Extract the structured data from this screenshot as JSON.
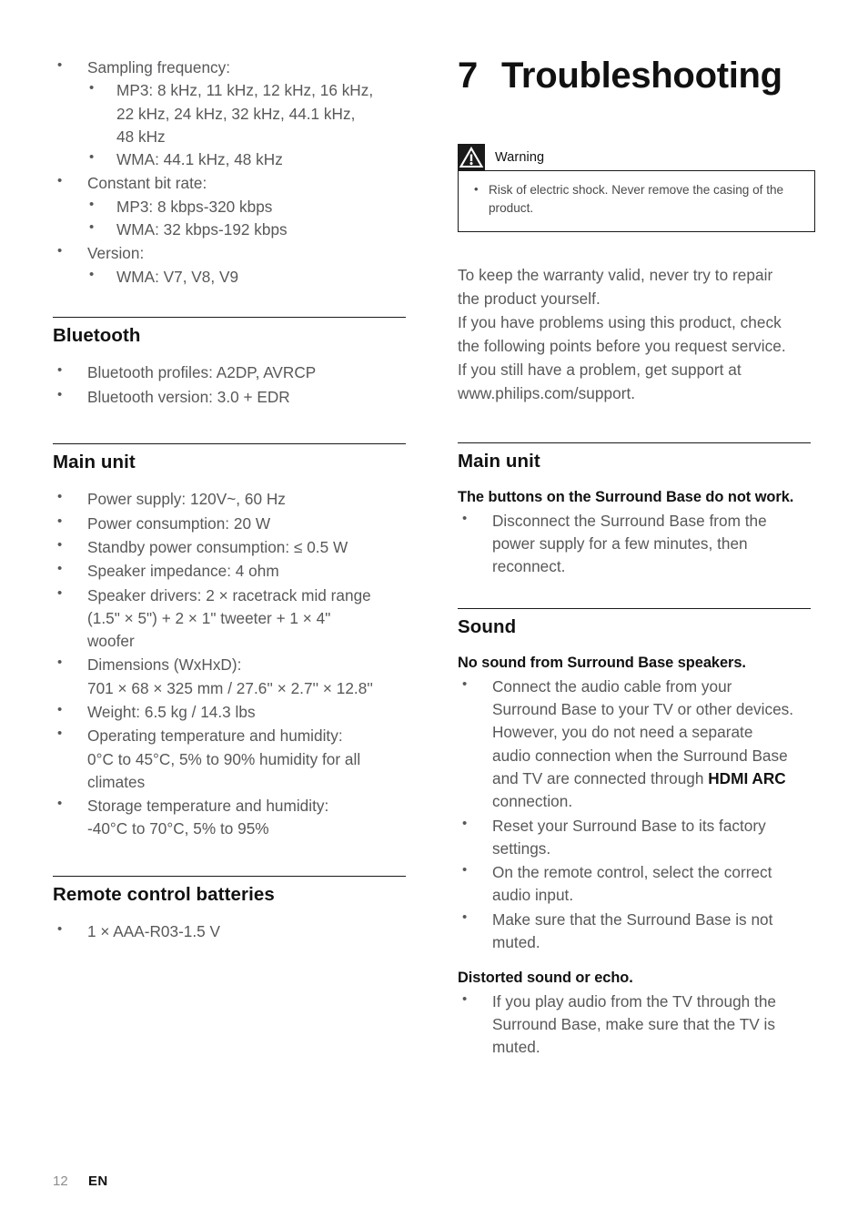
{
  "page": {
    "number": "12",
    "language": "EN"
  },
  "left_column": {
    "audio_specs": {
      "items": [
        {
          "label": "Sampling frequency:",
          "sub": [
            {
              "lines": [
                "MP3: 8 kHz, 11 kHz, 12 kHz, 16 kHz,",
                "22 kHz, 24 kHz, 32 kHz, 44.1 kHz,",
                "48 kHz"
              ]
            },
            {
              "lines": [
                "WMA: 44.1 kHz, 48 kHz"
              ]
            }
          ]
        },
        {
          "label": "Constant bit rate:",
          "sub": [
            {
              "lines": [
                "MP3: 8 kbps-320 kbps"
              ]
            },
            {
              "lines": [
                "WMA: 32 kbps-192 kbps"
              ]
            }
          ]
        },
        {
          "label": "Version:",
          "sub": [
            {
              "lines": [
                "WMA: V7, V8, V9"
              ]
            }
          ]
        }
      ]
    },
    "bluetooth": {
      "title": "Bluetooth",
      "items": [
        "Bluetooth profiles: A2DP, AVRCP",
        "Bluetooth version: 3.0 + EDR"
      ]
    },
    "main_unit": {
      "title": "Main unit",
      "items": [
        {
          "lines": [
            "Power supply: 120V~, 60 Hz"
          ]
        },
        {
          "lines": [
            "Power consumption: 20 W"
          ]
        },
        {
          "lines": [
            "Standby power consumption: ≤ 0.5 W"
          ]
        },
        {
          "lines": [
            "Speaker impedance: 4 ohm"
          ]
        },
        {
          "lines": [
            "Speaker drivers: 2 × racetrack mid range",
            "(1.5\" × 5\") + 2 × 1\" tweeter + 1 × 4\"",
            "woofer"
          ]
        },
        {
          "lines": [
            "Dimensions (WxHxD):",
            "701 × 68 × 325 mm / 27.6'' × 2.7'' × 12.8''"
          ]
        },
        {
          "lines": [
            "Weight: 6.5 kg / 14.3 lbs"
          ]
        },
        {
          "lines": [
            "Operating temperature and humidity:",
            "0°C to 45°C, 5% to 90% humidity for all",
            "climates"
          ]
        },
        {
          "lines": [
            "Storage temperature and humidity:",
            "-40°C to 70°C, 5% to 95%"
          ]
        }
      ]
    },
    "remote_batteries": {
      "title": "Remote control batteries",
      "items": [
        "1 × AAA-R03-1.5 V"
      ]
    }
  },
  "right_column": {
    "chapter": {
      "number": "7",
      "title": "Troubleshooting"
    },
    "warning": {
      "label": "Warning",
      "icon": "warning-triangle-icon",
      "items": [
        "Risk of electric shock. Never remove the casing of the product."
      ]
    },
    "intro": {
      "lines": [
        "To keep the warranty valid, never try to repair",
        "the product yourself.",
        "If you have problems using this product, check",
        "the following points before you request service.",
        "If you still have a problem, get support at",
        "www.philips.com/support."
      ]
    },
    "main_unit": {
      "title": "Main unit",
      "problems": [
        {
          "heading_lines": [
            "The buttons on the Surround Base do not",
            "work."
          ],
          "solutions": [
            {
              "lines": [
                "Disconnect the Surround Base from the",
                "power supply for a few minutes, then",
                "reconnect."
              ]
            }
          ]
        }
      ]
    },
    "sound": {
      "title": "Sound",
      "problems": [
        {
          "heading_lines": [
            "No sound from Surround Base speakers."
          ],
          "solutions": [
            {
              "lines": [
                "Connect the audio cable from your",
                "Surround Base to your TV or other devices.",
                "However, you do not need a separate",
                "audio connection when the Surround Base"
              ],
              "line_bold_tail": {
                "prefix": "and TV are connected through ",
                "bold": "HDMI ARC"
              },
              "tail_lines": [
                "connection."
              ]
            },
            {
              "lines": [
                "Reset your Surround Base to its factory",
                "settings."
              ]
            },
            {
              "lines": [
                "On the remote control, select the correct",
                "audio input."
              ]
            },
            {
              "lines": [
                "Make sure that the Surround Base is not",
                "muted."
              ]
            }
          ]
        },
        {
          "heading_lines": [
            "Distorted sound or echo."
          ],
          "solutions": [
            {
              "lines": [
                "If you play audio from the TV through the",
                "Surround Base, make sure that the TV is",
                "muted."
              ]
            }
          ]
        }
      ]
    }
  },
  "colors": {
    "body_text": "#58585a",
    "heading_text": "#111111",
    "rule": "#1a1a1a",
    "page_number": "#8d8d8d"
  }
}
